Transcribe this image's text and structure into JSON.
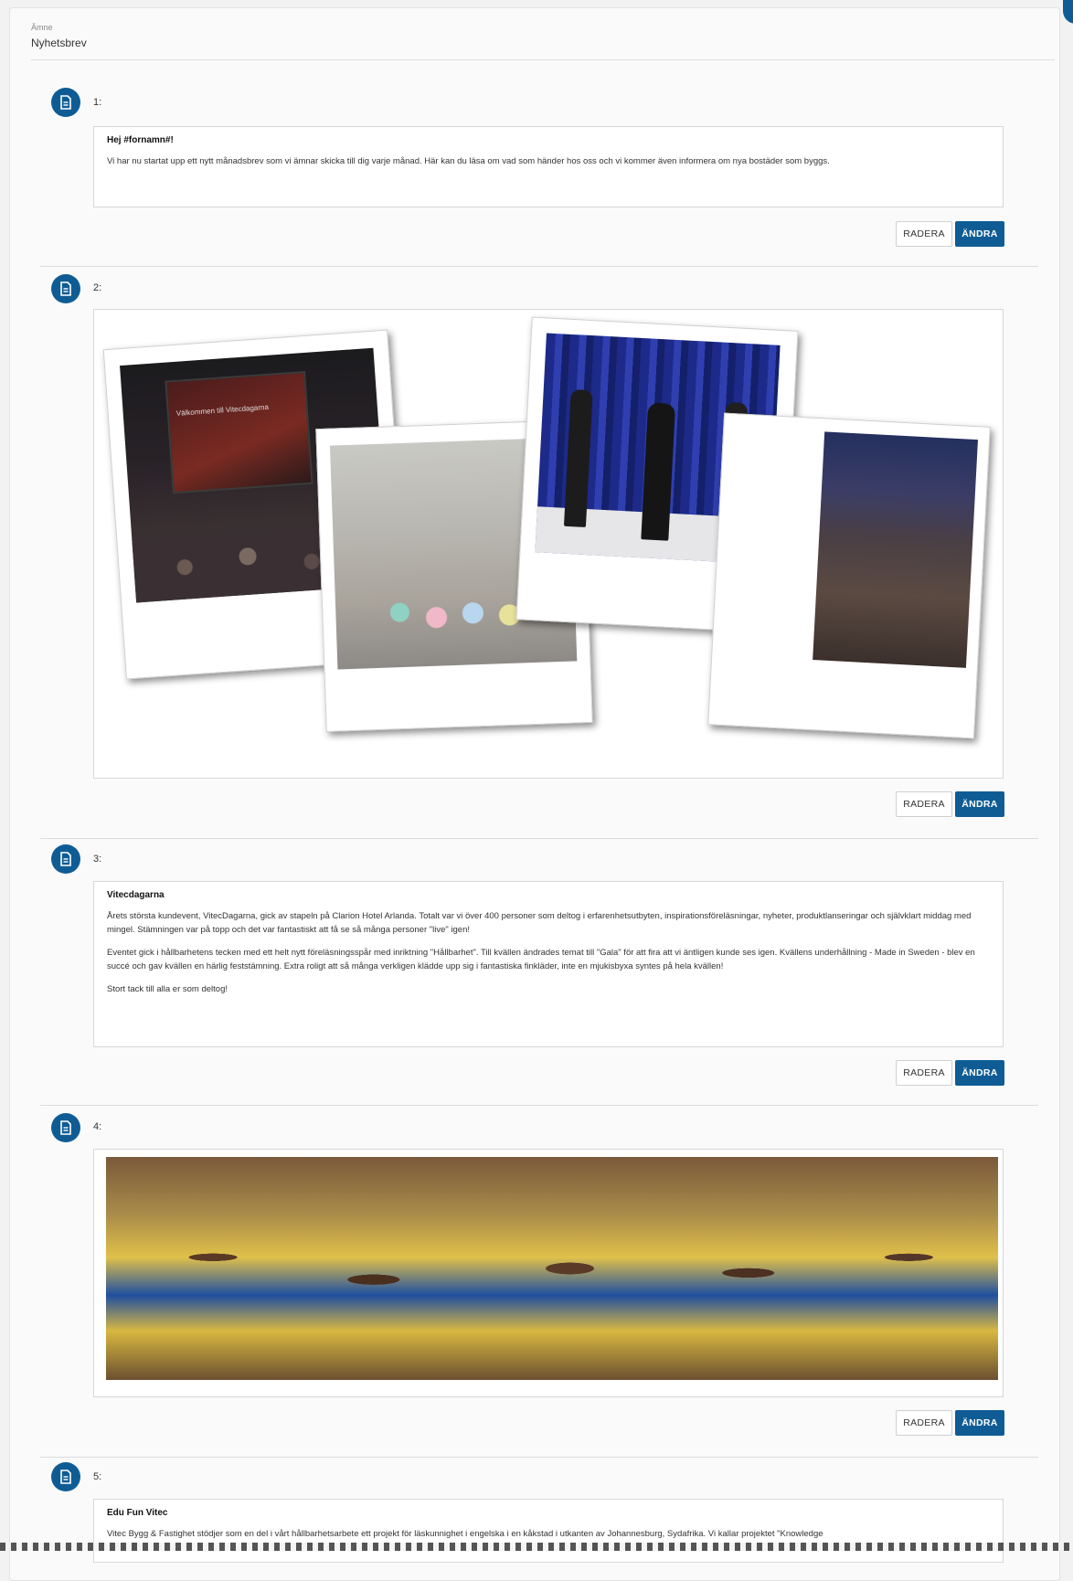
{
  "subject": {
    "label": "Ämne",
    "value": "Nyhetsbrev"
  },
  "buttons": {
    "delete": "RADERA",
    "edit": "ÄNDRA"
  },
  "blocks": [
    {
      "number": "1:",
      "type": "text",
      "heading": "Hej #fornamn#!",
      "paragraphs": [
        "Vi har nu startat upp ett nytt månadsbrev som vi ämnar skicka till dig varje månad. Här kan du läsa om vad som händer hos oss och vi kommer även informera om nya bostäder som byggs."
      ]
    },
    {
      "number": "2:",
      "type": "image",
      "photo_slide_text": "Välkommen till Vitecdagarna"
    },
    {
      "number": "3:",
      "type": "text",
      "heading": "Vitecdagarna",
      "paragraphs": [
        "Årets största kundevent, VitecDagarna, gick av stapeln på Clarion Hotel Arlanda. Totalt var vi över 400 personer som deltog i erfarenhetsutbyten, inspirationsföreläsningar, nyheter, produktlanseringar och självklart middag med mingel. Stämningen var på topp och det var fantastiskt att få se så många personer \"live\" igen!",
        "Eventet gick i hållbarhetens tecken med ett helt nytt föreläsningsspår med inriktning \"Hållbarhet\". Till kvällen ändrades temat till \"Gala\" för att fira att vi äntligen kunde ses igen. Kvällens underhållning - Made in Sweden - blev en succé och gav kvällen en härlig feststämning. Extra roligt att så många verkligen klädde upp sig i fantastiska finkläder, inte en mjukisbyxa syntes på hela kvällen!",
        "Stort tack till alla er som deltog!"
      ]
    },
    {
      "number": "4:",
      "type": "image"
    },
    {
      "number": "5:",
      "type": "text",
      "heading": "Edu Fun Vitec",
      "paragraphs": [
        "Vitec Bygg & Fastighet stödjer som en del i vårt hållbarhetsarbete ett projekt för läskunnighet i engelska i en kåkstad i utkanten av Johannesburg, Sydafrika. Vi kallar projektet \"Knowledge"
      ]
    }
  ],
  "colors": {
    "primary": "#0f5c95",
    "icon": "document-icon"
  }
}
